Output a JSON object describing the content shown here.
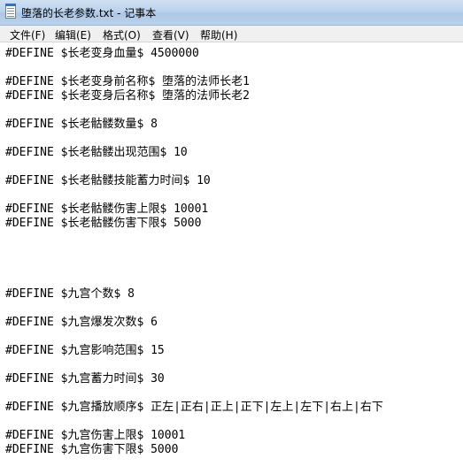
{
  "window": {
    "title": "堕落的长老参数.txt - 记事本"
  },
  "menu": {
    "items": [
      {
        "label": "文件(F)"
      },
      {
        "label": "编辑(E)"
      },
      {
        "label": "格式(O)"
      },
      {
        "label": "查看(V)"
      },
      {
        "label": "帮助(H)"
      }
    ]
  },
  "editor": {
    "lines": [
      "#DEFINE $长老变身血量$ 4500000",
      "#DEFINE $长老变身前名称$ 堕落的法师长老1",
      "#DEFINE $长老变身后名称$ 堕落的法师长老2",
      "#DEFINE $长老骷髅数量$ 8",
      "#DEFINE $长老骷髅出现范围$ 10",
      "#DEFINE $长老骷髅技能蓄力时间$ 10",
      "#DEFINE $长老骷髅伤害上限$ 10001",
      "#DEFINE $长老骷髅伤害下限$ 5000",
      "#DEFINE $九宫个数$ 8",
      "#DEFINE $九宫爆发次数$ 6",
      "#DEFINE $九宫影响范围$ 15",
      "#DEFINE $九宫蓄力时间$ 30",
      "#DEFINE $九宫播放顺序$ 正左|正右|正上|正下|左上|左下|右上|右下",
      "#DEFINE $九宫伤害上限$ 10001",
      "#DEFINE $九宫伤害下限$ 5000"
    ]
  }
}
